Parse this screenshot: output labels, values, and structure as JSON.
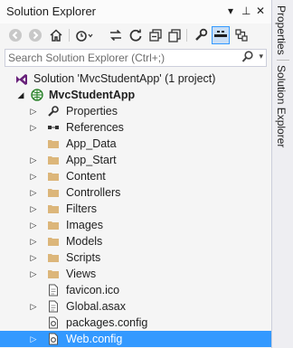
{
  "window": {
    "title": "Solution Explorer",
    "pin_glyph": "▾",
    "autohide_glyph": "⊥",
    "close_glyph": "✕"
  },
  "toolbar": {
    "icons": [
      "back-icon",
      "forward-icon",
      "home-icon",
      "pending-changes-icon",
      "sync-icon",
      "refresh-icon",
      "collapse-all-icon",
      "show-all-files-icon",
      "properties-icon",
      "preview-icon",
      "class-view-icon"
    ]
  },
  "search": {
    "placeholder": "Search Solution Explorer (Ctrl+;)"
  },
  "tree": {
    "solution": "Solution 'MvcStudentApp' (1 project)",
    "project": "MvcStudentApp",
    "items": [
      {
        "label": "Properties",
        "type": "properties"
      },
      {
        "label": "References",
        "type": "references"
      },
      {
        "label": "App_Data",
        "type": "folder"
      },
      {
        "label": "App_Start",
        "type": "folder"
      },
      {
        "label": "Content",
        "type": "folder"
      },
      {
        "label": "Controllers",
        "type": "folder"
      },
      {
        "label": "Filters",
        "type": "folder"
      },
      {
        "label": "Images",
        "type": "folder"
      },
      {
        "label": "Models",
        "type": "folder"
      },
      {
        "label": "Scripts",
        "type": "folder"
      },
      {
        "label": "Views",
        "type": "folder"
      },
      {
        "label": "favicon.ico",
        "type": "file"
      },
      {
        "label": "Global.asax",
        "type": "file"
      },
      {
        "label": "packages.config",
        "type": "config"
      },
      {
        "label": "Web.config",
        "type": "config",
        "selected": true
      }
    ]
  },
  "side_tabs": {
    "properties": "Properties",
    "solution_explorer": "Solution Explorer"
  },
  "colors": {
    "selection": "#3399ff",
    "folder": "#dcb67a",
    "panel_bg": "#f5f5f5"
  }
}
